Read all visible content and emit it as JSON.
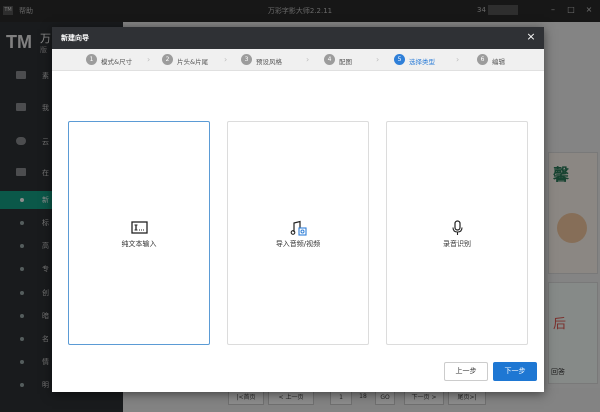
{
  "titlebar": {
    "logo": "TM",
    "help": "帮助",
    "title": "万彩字影大师2.2.11",
    "code": "34"
  },
  "sidebar": {
    "brand": "TM",
    "brand_text": "万",
    "brand_sub": "版",
    "icon_items": [
      {
        "label": "素"
      },
      {
        "label": "我"
      },
      {
        "label": "云"
      },
      {
        "label": "在"
      }
    ],
    "items": [
      {
        "label": "新"
      },
      {
        "label": "标"
      },
      {
        "label": "高"
      },
      {
        "label": "专"
      },
      {
        "label": "创"
      },
      {
        "label": "暗"
      },
      {
        "label": "名"
      },
      {
        "label": "情"
      },
      {
        "label": "明"
      }
    ]
  },
  "background": {
    "card_text_1": "馨",
    "card_text_2": "后",
    "card_text_3": "回答"
  },
  "pagination": {
    "first": "|<首页",
    "prev": "< 上一页",
    "page": "1",
    "total": "18",
    "go": "GO",
    "next": "下一页 >",
    "last": "尾页>|"
  },
  "dialog": {
    "title": "新建向导",
    "close": "×",
    "steps": [
      {
        "num": "1",
        "label": "模式&尺寸"
      },
      {
        "num": "2",
        "label": "片头&片尾"
      },
      {
        "num": "3",
        "label": "预设风格"
      },
      {
        "num": "4",
        "label": "配图"
      },
      {
        "num": "5",
        "label": "选择类型"
      },
      {
        "num": "6",
        "label": "编辑"
      }
    ],
    "active_step": 5,
    "options": [
      {
        "label": "纯文本输入",
        "icon": "text-input-icon"
      },
      {
        "label": "导入音频/视频",
        "icon": "music-video-icon"
      },
      {
        "label": "录音识别",
        "icon": "microphone-icon"
      }
    ],
    "prev_label": "上一步",
    "next_label": "下一步"
  },
  "colors": {
    "accent": "#1e77d3",
    "active_step": "#2f7fd8",
    "sidebar_active": "#14a085",
    "header": "#2f3135"
  }
}
